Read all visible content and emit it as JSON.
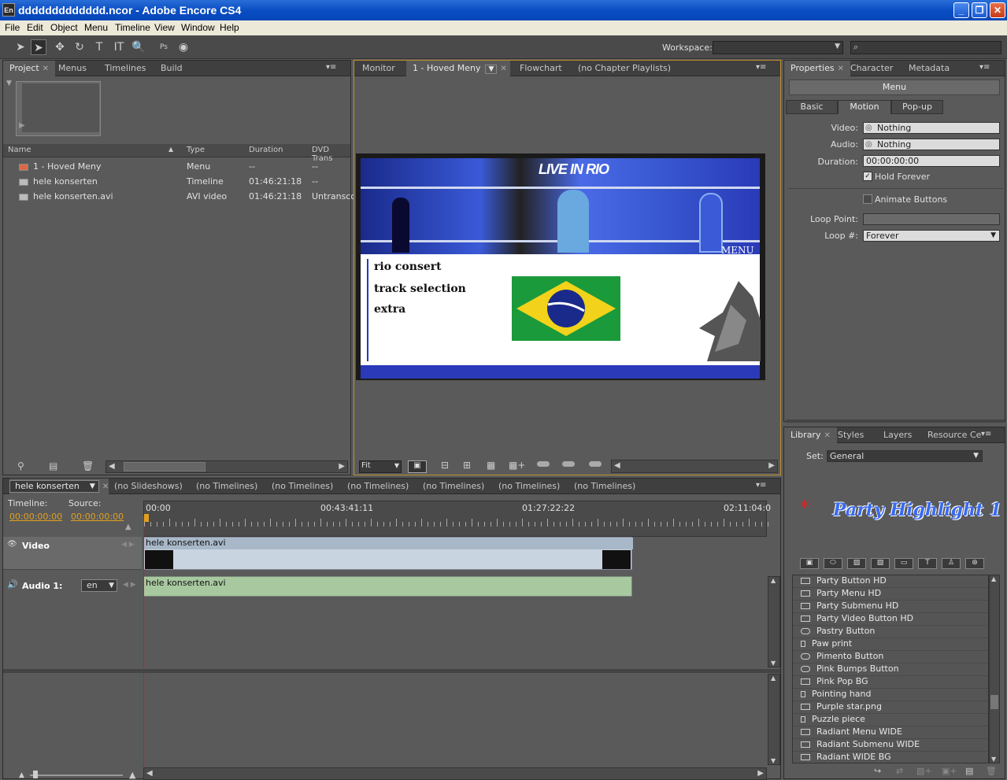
{
  "window": {
    "title": "ddddddddddddd.ncor - Adobe Encore CS4",
    "app_icon": "En"
  },
  "menubar": [
    "File",
    "Edit",
    "Object",
    "Menu",
    "Timeline",
    "View",
    "Window",
    "Help"
  ],
  "toolbar": {
    "workspace_label": "Workspace:"
  },
  "project_panel": {
    "tabs": [
      "Project",
      "Menus",
      "Timelines",
      "Build"
    ],
    "columns": [
      "Name",
      "Type",
      "Duration",
      "DVD Trans"
    ],
    "rows": [
      {
        "name": "1 - Hoved Meny",
        "type": "Menu",
        "duration": "--",
        "dvd": "--",
        "icon": "menu-icon"
      },
      {
        "name": "hele konserten",
        "type": "Timeline",
        "duration": "01:46:21:18",
        "dvd": "--",
        "icon": "timeline-icon"
      },
      {
        "name": "hele konserten.avi",
        "type": "AVI video",
        "duration": "01:46:21:18",
        "dvd": "Untransco",
        "icon": "video-file-icon"
      }
    ]
  },
  "monitor_panel": {
    "tabs": [
      "Monitor",
      "1 - Hoved Meny",
      "Flowchart",
      "(no Chapter Playlists)"
    ],
    "zoom": "Fit",
    "menu_preview": {
      "banner_title": "LIVE IN RIO",
      "banner_menu": "MENU",
      "items": [
        "rio consert",
        "track selection",
        "extra"
      ]
    }
  },
  "properties_panel": {
    "tabs": [
      "Properties",
      "Character",
      "Metadata"
    ],
    "header": "Menu",
    "subtabs": [
      "Basic",
      "Motion",
      "Pop-up"
    ],
    "video_label": "Video:",
    "video_value": "Nothing",
    "audio_label": "Audio:",
    "audio_value": "Nothing",
    "duration_label": "Duration:",
    "duration_value": "00:00:00:00",
    "hold_forever": "Hold Forever",
    "animate_buttons": "Animate Buttons",
    "loop_point_label": "Loop Point:",
    "loop_count_label": "Loop #:",
    "loop_count_value": "Forever"
  },
  "library_panel": {
    "tabs": [
      "Library",
      "Styles",
      "Layers",
      "Resource Ce"
    ],
    "set_label": "Set:",
    "set_value": "General",
    "preview_text": "Party Highlight 1",
    "items": [
      "Party Button HD",
      "Party Menu HD",
      "Party Submenu HD",
      "Party Video Button HD",
      "Pastry Button",
      "Paw print",
      "Pimento Button",
      "Pink Bumps Button",
      "Pink Pop BG",
      "Pointing hand",
      "Purple star.png",
      "Puzzle piece",
      "Radiant Menu WIDE",
      "Radiant Submenu WIDE",
      "Radiant WIDE BG"
    ]
  },
  "timeline_panel": {
    "selector": "hele konserten",
    "tabs": [
      "(no Slideshows)",
      "(no Timelines)",
      "(no Timelines)",
      "(no Timelines)",
      "(no Timelines)",
      "(no Timelines)",
      "(no Timelines)"
    ],
    "timeline_label": "Timeline:",
    "timeline_tc": "00:00:00:00",
    "source_label": "Source:",
    "source_tc": "00:00:00:00",
    "ruler": [
      "00:00",
      "00:43:41:11",
      "01:27:22:22",
      "02:11:04:0"
    ],
    "video_track": "Video",
    "video_clip": "hele konserten.avi",
    "audio_track": "Audio 1:",
    "audio_lang": "en",
    "audio_clip": "hele konserten.avi"
  }
}
